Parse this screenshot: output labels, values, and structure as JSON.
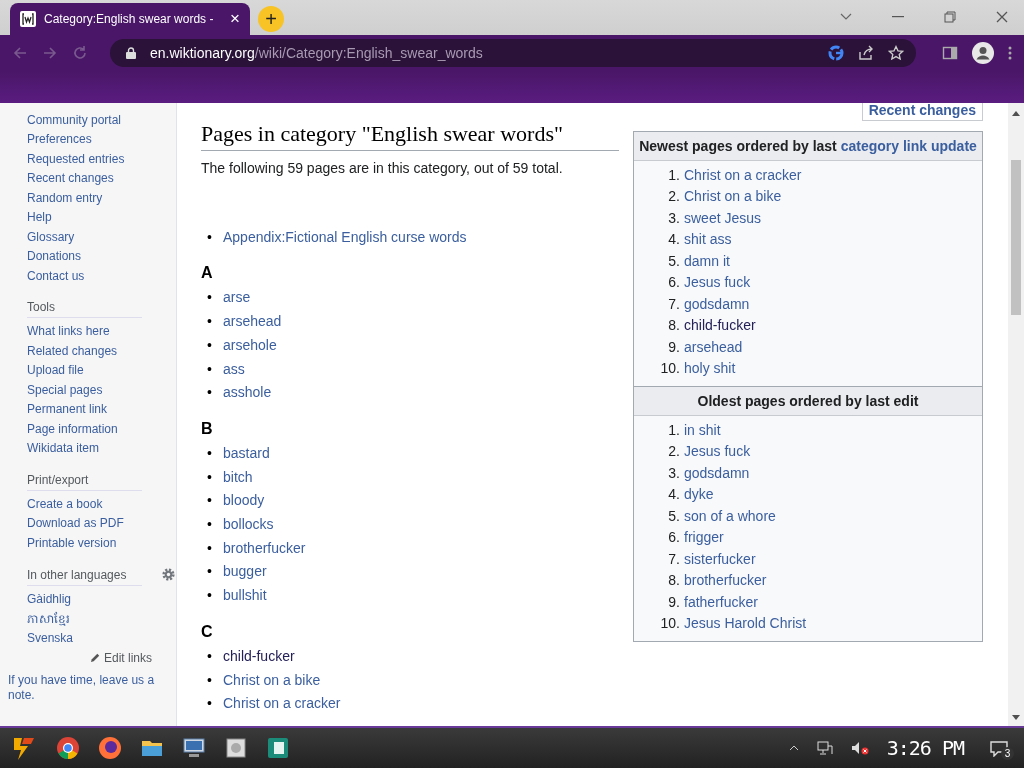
{
  "browser": {
    "tab": {
      "title": "Category:English swear words -",
      "close": "×",
      "selected": true
    },
    "new_tab": "+",
    "address": {
      "host": "en.wiktionary.org",
      "path": "/wiki/Category:English_swear_words"
    }
  },
  "sidebar": {
    "sections": [
      {
        "items": [
          "Community portal",
          "Preferences",
          "Requested entries",
          "Recent changes",
          "Random entry",
          "Help",
          "Glossary",
          "Donations",
          "Contact us"
        ]
      },
      {
        "heading": "Tools",
        "items": [
          "What links here",
          "Related changes",
          "Upload file",
          "Special pages",
          "Permanent link",
          "Page information",
          "Wikidata item"
        ]
      },
      {
        "heading": "Print/export",
        "items": [
          "Create a book",
          "Download as PDF",
          "Printable version"
        ]
      },
      {
        "heading": "In other languages",
        "kind": "languages",
        "items": [
          "Gàidhlig",
          "ភាសាខ្មែរ",
          "Svenska"
        ],
        "edit_links": "Edit links"
      }
    ],
    "note": "If you have time, leave us a note."
  },
  "main": {
    "heading": "Pages in category \"English swear words\"",
    "intro": "The following 59 pages are in this category, out of 59 total.",
    "pages": [
      {
        "marker": "•",
        "label": "Appendix:Fictional English curse words",
        "visited": false
      }
    ],
    "groups": [
      {
        "letter": "A",
        "items": [
          {
            "marker": "•",
            "label": "arse",
            "visited": false
          },
          {
            "marker": "•",
            "label": "arsehead",
            "visited": false
          },
          {
            "marker": "•",
            "label": "arsehole",
            "visited": false
          },
          {
            "marker": "•",
            "label": "ass",
            "visited": false
          },
          {
            "marker": "•",
            "label": "asshole",
            "visited": false
          }
        ]
      },
      {
        "letter": "B",
        "items": [
          {
            "marker": "•",
            "label": "bastard",
            "visited": false
          },
          {
            "marker": "•",
            "label": "bitch",
            "visited": false
          },
          {
            "marker": "•",
            "label": "bloody",
            "visited": false
          },
          {
            "marker": "•",
            "label": "bollocks",
            "visited": false
          },
          {
            "marker": "•",
            "label": "brotherfucker",
            "visited": false
          },
          {
            "marker": "•",
            "label": "bugger",
            "visited": false
          },
          {
            "marker": "•",
            "label": "bullshit",
            "visited": false
          }
        ]
      },
      {
        "letter": "C",
        "items": [
          {
            "marker": "•",
            "label": "child-fucker",
            "visited": true
          },
          {
            "marker": "•",
            "label": "Christ on a bike",
            "visited": false
          },
          {
            "marker": "•",
            "label": "Christ on a cracker",
            "visited": false
          }
        ]
      }
    ]
  },
  "aside": {
    "recent_changes": "Recent changes",
    "boxes": [
      {
        "title": "Newest pages ordered by last ",
        "title_link": "category link update",
        "items": [
          {
            "number": "1.",
            "label": "Christ on a cracker",
            "visited": false
          },
          {
            "number": "2.",
            "label": "Christ on a bike",
            "visited": false
          },
          {
            "number": "3.",
            "label": "sweet Jesus",
            "visited": false
          },
          {
            "number": "4.",
            "label": "shit ass",
            "visited": false
          },
          {
            "number": "5.",
            "label": "damn it",
            "visited": false
          },
          {
            "number": "6.",
            "label": "Jesus fuck",
            "visited": false
          },
          {
            "number": "7.",
            "label": "godsdamn",
            "visited": false
          },
          {
            "number": "8.",
            "label": "child-fucker",
            "visited": true
          },
          {
            "number": "9.",
            "label": "arsehead",
            "visited": false
          },
          {
            "number": "10.",
            "label": "holy shit",
            "visited": false
          }
        ]
      },
      {
        "title": "Oldest pages ordered by last edit",
        "items": [
          {
            "number": "1.",
            "label": "in shit",
            "visited": false
          },
          {
            "number": "2.",
            "label": "Jesus fuck",
            "visited": false
          },
          {
            "number": "3.",
            "label": "godsdamn",
            "visited": false
          },
          {
            "number": "4.",
            "label": "dyke",
            "visited": false
          },
          {
            "number": "5.",
            "label": "son of a whore",
            "visited": false
          },
          {
            "number": "6.",
            "label": "frigger",
            "visited": false
          },
          {
            "number": "7.",
            "label": "sisterfucker",
            "visited": false
          },
          {
            "number": "8.",
            "label": "brotherfucker",
            "visited": false
          },
          {
            "number": "9.",
            "label": "fatherfucker",
            "visited": false
          },
          {
            "number": "10.",
            "label": "Jesus Harold Christ",
            "visited": false
          }
        ]
      }
    ]
  },
  "taskbar": {
    "time": "3:26 PM",
    "notifications": "3"
  }
}
